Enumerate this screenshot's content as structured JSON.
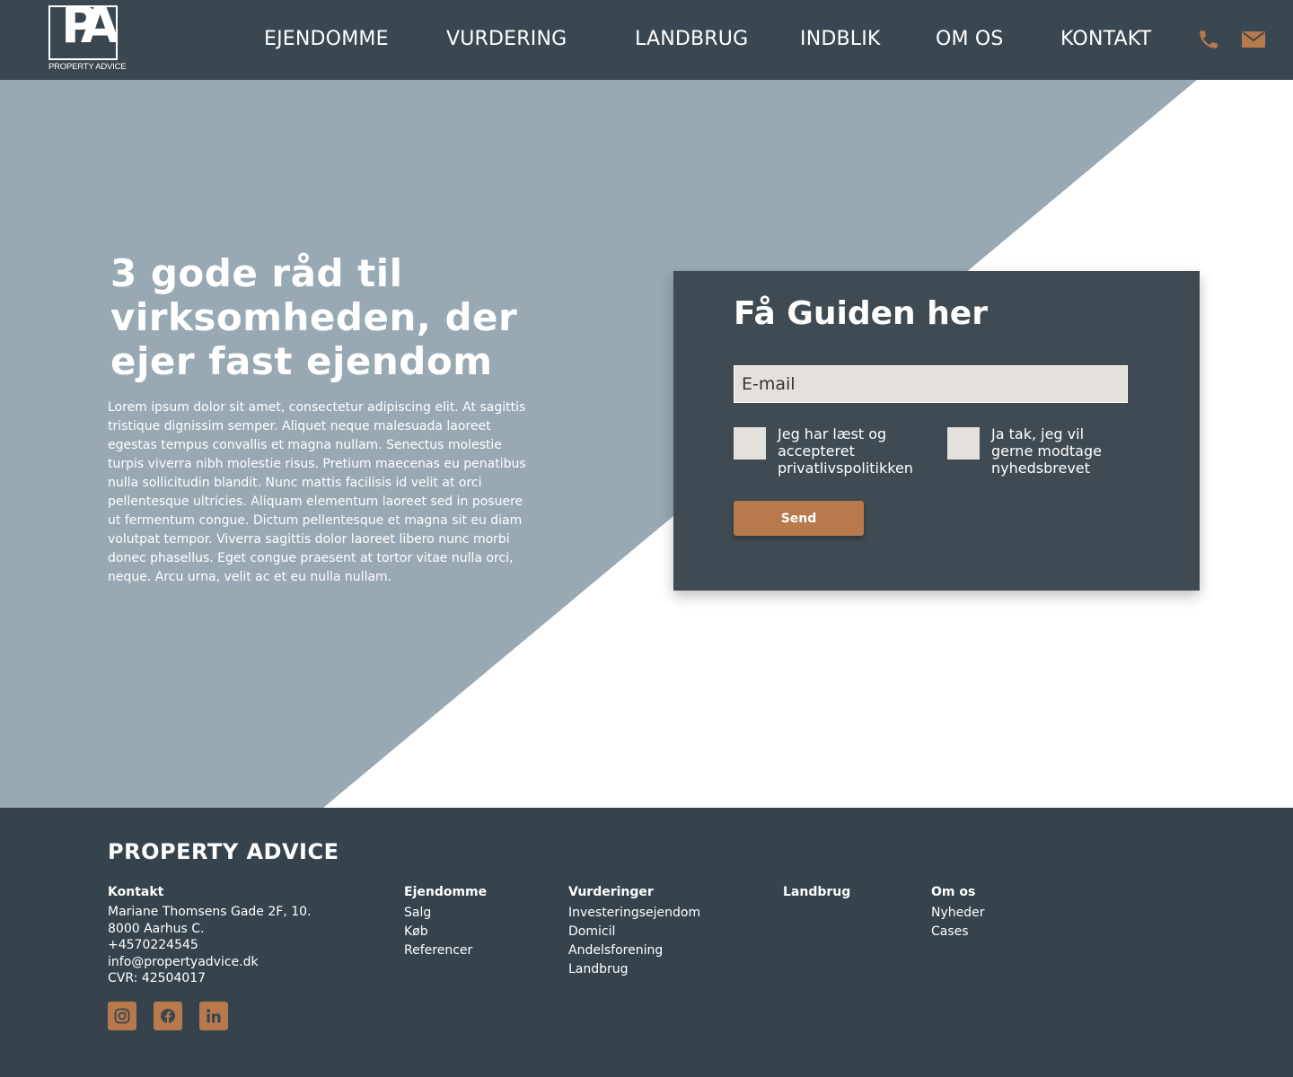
{
  "colors": {
    "header_bg": "#3b4750",
    "hero_triangle": "#98a9b3",
    "card_bg": "#3f4a52",
    "accent": "#b87a4c",
    "footer_bg": "#36434c",
    "input_bg": "#e4e1dc"
  },
  "header": {
    "logo_text": "PA",
    "logo_subtitle": "PROPERTY ADVICE",
    "nav": [
      "EJENDOMME",
      "VURDERING",
      "LANDBRUG",
      "INDBLIK",
      "OM OS",
      "KONTAKT"
    ],
    "icons": [
      "phone-icon",
      "mail-icon"
    ]
  },
  "hero": {
    "title": "3 gode råd til virksomheden, der ejer fast ejendom",
    "body": "Lorem ipsum dolor sit amet, consectetur adipiscing elit. At sagittis tristique dignissim semper. Aliquet neque malesuada laoreet egestas tempus convallis et magna nullam. Senectus molestie turpis viverra nibh molestie risus. Pretium maecenas eu penatibus nulla sollicitudin blandit. Nunc mattis facilisis id velit at orci pellentesque ultricies. Aliquam elementum laoreet sed in posuere ut fermentum congue. Dictum pellentesque et magna sit eu diam volutpat tempor. Viverra sagittis dolor laoreet libero nunc morbi donec phasellus. Eget congue praesent at tortor vitae nulla orci, neque. Arcu urna, velit ac et eu nulla nullam."
  },
  "form": {
    "title": "Få Guiden her",
    "email_placeholder": "E-mail",
    "checkbox_privacy": "Jeg har læst og accepteret privatlivspolitikken",
    "checkbox_newsletter": "Ja tak, jeg vil gerne modtage nyhedsbrevet",
    "submit_label": "Send"
  },
  "footer": {
    "brand": "PROPERTY ADVICE",
    "contact": {
      "heading": "Kontakt",
      "lines": [
        "Mariane Thomsens Gade 2F, 10.",
        "8000 Aarhus C.",
        "+4570224545",
        "info@propertyadvice.dk",
        "CVR: 42504017"
      ]
    },
    "columns": [
      {
        "heading": "Ejendomme",
        "links": [
          "Salg",
          "Køb",
          "Referencer"
        ]
      },
      {
        "heading": "Vurderinger",
        "links": [
          "Investeringsejendom",
          "Domicil",
          "Andelsforening",
          "Landbrug"
        ]
      },
      {
        "heading": "Landbrug",
        "links": []
      },
      {
        "heading": "Om os",
        "links": [
          "Nyheder",
          "Cases"
        ]
      }
    ],
    "social": [
      "instagram-icon",
      "facebook-icon",
      "linkedin-icon"
    ]
  }
}
